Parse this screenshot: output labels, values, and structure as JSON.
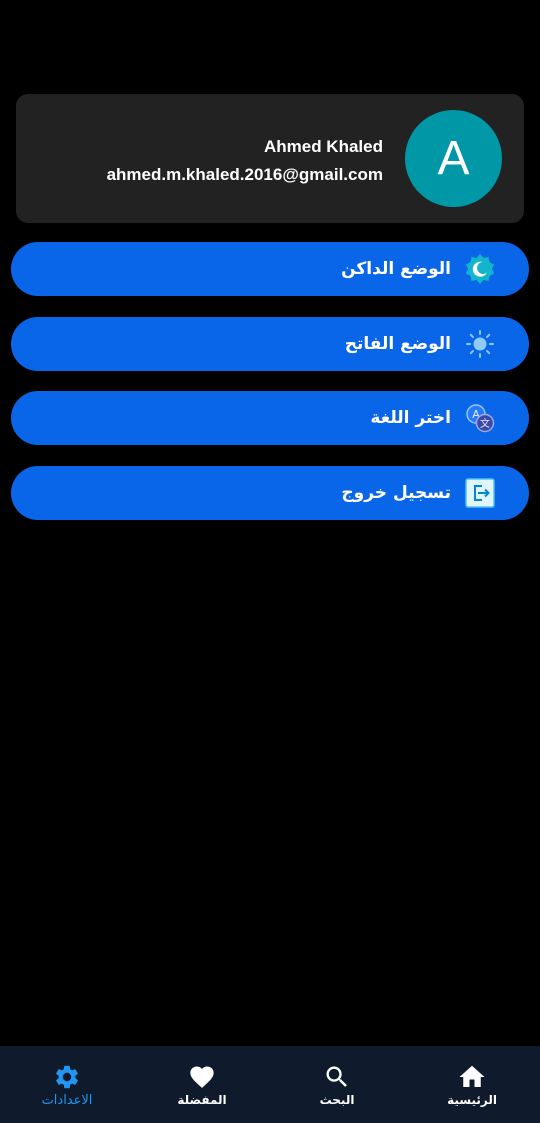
{
  "profile": {
    "avatar_letter": "A",
    "name": "Ahmed Khaled",
    "email": "ahmed.m.khaled.2016@gmail.com"
  },
  "menu": [
    {
      "label": "الوضع الداكن",
      "icon": "dark-mode-icon"
    },
    {
      "label": "الوضع الفاتح",
      "icon": "light-mode-icon"
    },
    {
      "label": "اختر اللغة",
      "icon": "translate-icon"
    },
    {
      "label": "تسجيل خروج",
      "icon": "logout-icon"
    }
  ],
  "bottom_nav": {
    "home": "الرئيسية",
    "search": "البحث",
    "favorites": "المفضلة",
    "settings": "الاعدادات",
    "active": "settings"
  },
  "colors": {
    "background": "#000000",
    "card": "#222222",
    "avatar": "#0097a7",
    "button": "#0a66e8",
    "nav_bg": "#0f1a2c",
    "nav_active": "#2196f3"
  }
}
